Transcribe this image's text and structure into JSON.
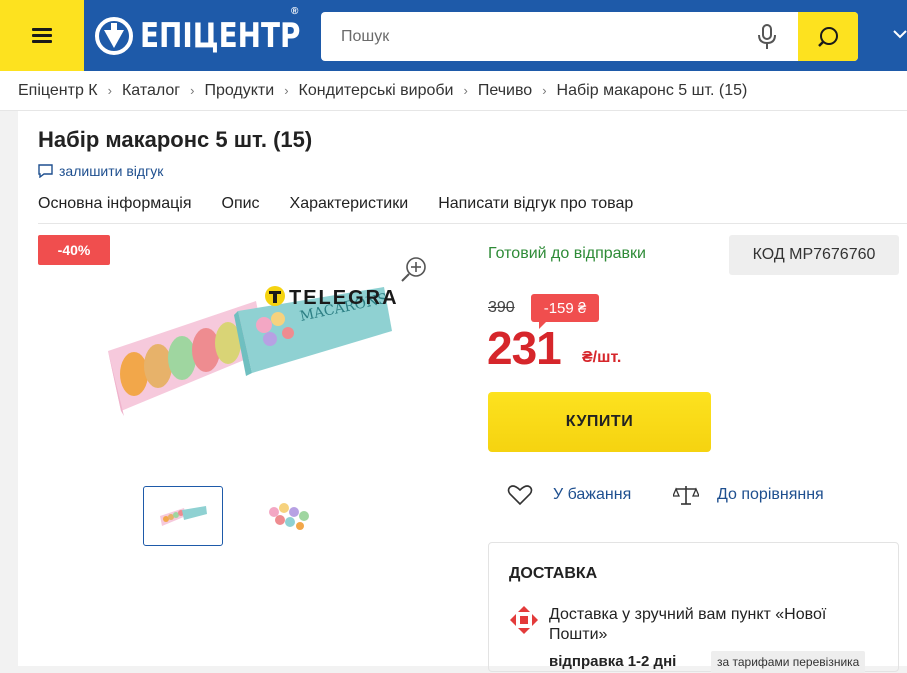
{
  "header": {
    "menu_icon": "hamburger-icon",
    "logo_text": "ЕПІЦЕНТР",
    "logo_reg": "®",
    "search_placeholder": "Пошук",
    "mic_icon": "microphone-icon",
    "search_icon": "search-icon",
    "accent_color": "#fde21f",
    "brand_color": "#1e5aa9"
  },
  "breadcrumbs": [
    "Епіцентр К",
    "Каталог",
    "Продукти",
    "Кондитерські вироби",
    "Печиво",
    "Набір макаронс 5 шт. (15)"
  ],
  "product": {
    "title": "Набір макаронс 5 шт. (15)",
    "review_link": "залишити відгук",
    "tabs": [
      "Основна інформація",
      "Опис",
      "Характеристики",
      "Написати відгук про товар"
    ],
    "badge": "-40%",
    "watermark": "TELEGRAF",
    "box_text": "MACARONS",
    "status": "Готовий до відправки",
    "code": "КОД MP7676760",
    "old_price": "390",
    "discount": "-159 ₴",
    "price": "231",
    "unit": "₴/шт.",
    "buy_label": "КУПИТИ",
    "wishlist_label": "У бажання",
    "compare_label": "До порівняння"
  },
  "delivery": {
    "title": "ДОСТАВКА",
    "text": "Доставка у зручний вам пункт «Нової Пошти»",
    "time": "відправка 1-2 дні",
    "tariff": "за тарифами перевізника"
  }
}
